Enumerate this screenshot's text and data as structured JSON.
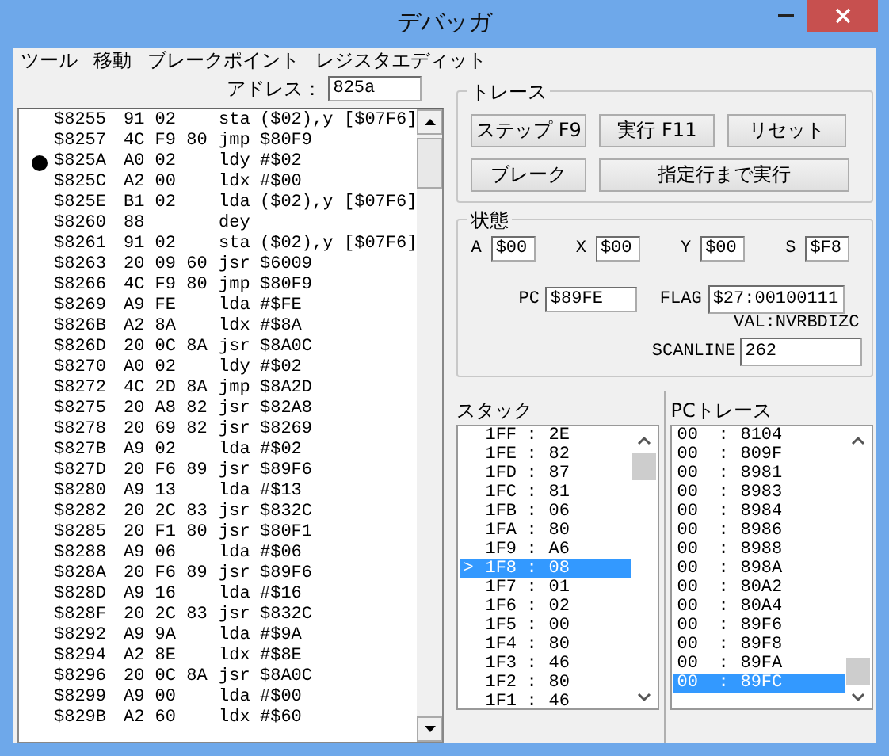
{
  "window": {
    "title": "デバッガ"
  },
  "menu": [
    "ツール",
    "移動",
    "ブレークポイント",
    "レジスタエディット"
  ],
  "address": {
    "label": "アドレス：",
    "value": "825a"
  },
  "disassembly": [
    {
      "address": "$8255",
      "bytes": "91 02",
      "mnemonic": "sta",
      "operand": "($02),y",
      "effective": "[$07F6]",
      "breakpoint": false
    },
    {
      "address": "$8257",
      "bytes": "4C F9 80",
      "mnemonic": "jmp",
      "operand": "$80F9",
      "breakpoint": false
    },
    {
      "address": "$825A",
      "bytes": "A0 02",
      "mnemonic": "ldy",
      "operand": "#$02",
      "breakpoint": true
    },
    {
      "address": "$825C",
      "bytes": "A2 00",
      "mnemonic": "ldx",
      "operand": "#$00",
      "breakpoint": false
    },
    {
      "address": "$825E",
      "bytes": "B1 02",
      "mnemonic": "lda",
      "operand": "($02),y",
      "effective": "[$07F6]",
      "breakpoint": false
    },
    {
      "address": "$8260",
      "bytes": "88",
      "mnemonic": "dey",
      "breakpoint": false
    },
    {
      "address": "$8261",
      "bytes": "91 02",
      "mnemonic": "sta",
      "operand": "($02),y",
      "effective": "[$07F6]",
      "breakpoint": false
    },
    {
      "address": "$8263",
      "bytes": "20 09 60",
      "mnemonic": "jsr",
      "operand": "$6009",
      "breakpoint": false
    },
    {
      "address": "$8266",
      "bytes": "4C F9 80",
      "mnemonic": "jmp",
      "operand": "$80F9",
      "breakpoint": false
    },
    {
      "address": "$8269",
      "bytes": "A9 FE",
      "mnemonic": "lda",
      "operand": "#$FE",
      "breakpoint": false
    },
    {
      "address": "$826B",
      "bytes": "A2 8A",
      "mnemonic": "ldx",
      "operand": "#$8A",
      "breakpoint": false
    },
    {
      "address": "$826D",
      "bytes": "20 0C 8A",
      "mnemonic": "jsr",
      "operand": "$8A0C",
      "breakpoint": false
    },
    {
      "address": "$8270",
      "bytes": "A0 02",
      "mnemonic": "ldy",
      "operand": "#$02",
      "breakpoint": false
    },
    {
      "address": "$8272",
      "bytes": "4C 2D 8A",
      "mnemonic": "jmp",
      "operand": "$8A2D",
      "breakpoint": false
    },
    {
      "address": "$8275",
      "bytes": "20 A8 82",
      "mnemonic": "jsr",
      "operand": "$82A8",
      "breakpoint": false
    },
    {
      "address": "$8278",
      "bytes": "20 69 82",
      "mnemonic": "jsr",
      "operand": "$8269",
      "breakpoint": false
    },
    {
      "address": "$827B",
      "bytes": "A9 02",
      "mnemonic": "lda",
      "operand": "#$02",
      "breakpoint": false
    },
    {
      "address": "$827D",
      "bytes": "20 F6 89",
      "mnemonic": "jsr",
      "operand": "$89F6",
      "breakpoint": false
    },
    {
      "address": "$8280",
      "bytes": "A9 13",
      "mnemonic": "lda",
      "operand": "#$13",
      "breakpoint": false
    },
    {
      "address": "$8282",
      "bytes": "20 2C 83",
      "mnemonic": "jsr",
      "operand": "$832C",
      "breakpoint": false
    },
    {
      "address": "$8285",
      "bytes": "20 F1 80",
      "mnemonic": "jsr",
      "operand": "$80F1",
      "breakpoint": false
    },
    {
      "address": "$8288",
      "bytes": "A9 06",
      "mnemonic": "lda",
      "operand": "#$06",
      "breakpoint": false
    },
    {
      "address": "$828A",
      "bytes": "20 F6 89",
      "mnemonic": "jsr",
      "operand": "$89F6",
      "breakpoint": false
    },
    {
      "address": "$828D",
      "bytes": "A9 16",
      "mnemonic": "lda",
      "operand": "#$16",
      "breakpoint": false
    },
    {
      "address": "$828F",
      "bytes": "20 2C 83",
      "mnemonic": "jsr",
      "operand": "$832C",
      "breakpoint": false
    },
    {
      "address": "$8292",
      "bytes": "A9 9A",
      "mnemonic": "lda",
      "operand": "#$9A",
      "breakpoint": false
    },
    {
      "address": "$8294",
      "bytes": "A2 8E",
      "mnemonic": "ldx",
      "operand": "#$8E",
      "breakpoint": false
    },
    {
      "address": "$8296",
      "bytes": "20 0C 8A",
      "mnemonic": "jsr",
      "operand": "$8A0C",
      "breakpoint": false
    },
    {
      "address": "$8299",
      "bytes": "A9 00",
      "mnemonic": "lda",
      "operand": "#$00",
      "breakpoint": false
    },
    {
      "address": "$829B",
      "bytes": "A2 60",
      "mnemonic": "ldx",
      "operand": "#$60",
      "breakpoint": false
    }
  ],
  "trace": {
    "title": "トレース",
    "buttons": [
      [
        "ステップ F9",
        "実行 F11",
        "リセット"
      ],
      [
        "ブレーク",
        "指定行まで実行"
      ]
    ]
  },
  "status": {
    "title": "状態",
    "registers": [
      {
        "label": "A",
        "value": "$00"
      },
      {
        "label": "X",
        "value": "$00"
      },
      {
        "label": "Y",
        "value": "$00"
      },
      {
        "label": "S",
        "value": "$F8"
      }
    ],
    "pc": {
      "label": "PC",
      "value": "$89FE"
    },
    "flag": {
      "label": "FLAG",
      "value": "$27:00100111",
      "note": "VAL:NVRBDIZC"
    },
    "scanline": {
      "label": "SCANLINE",
      "value": "262"
    }
  },
  "stack": {
    "title": "スタック",
    "items": [
      {
        "address": "1FF",
        "separator": ":",
        "value": "2E",
        "selected": false
      },
      {
        "address": "1FE",
        "separator": ":",
        "value": "82",
        "selected": false
      },
      {
        "address": "1FD",
        "separator": ":",
        "value": "87",
        "selected": false
      },
      {
        "address": "1FC",
        "separator": ":",
        "value": "81",
        "selected": false
      },
      {
        "address": "1FB",
        "separator": ":",
        "value": "06",
        "selected": false
      },
      {
        "address": "1FA",
        "separator": ":",
        "value": "80",
        "selected": false
      },
      {
        "address": "1F9",
        "separator": ":",
        "value": "A6",
        "selected": false
      },
      {
        "address": "1F8",
        "separator": ":",
        "value": "08",
        "selected": true,
        "pointer": ">"
      },
      {
        "address": "1F7",
        "separator": ":",
        "value": "01",
        "selected": false
      },
      {
        "address": "1F6",
        "separator": ":",
        "value": "02",
        "selected": false
      },
      {
        "address": "1F5",
        "separator": ":",
        "value": "00",
        "selected": false
      },
      {
        "address": "1F4",
        "separator": ":",
        "value": "80",
        "selected": false
      },
      {
        "address": "1F3",
        "separator": ":",
        "value": "46",
        "selected": false
      },
      {
        "address": "1F2",
        "separator": ":",
        "value": "80",
        "selected": false
      },
      {
        "address": "1F1",
        "separator": ":",
        "value": "46",
        "selected": false
      }
    ]
  },
  "pc_trace": {
    "title": "PCトレース",
    "items": [
      {
        "bank": "00",
        "separator": ":",
        "address": "8104",
        "selected": false
      },
      {
        "bank": "00",
        "separator": ":",
        "address": "809F",
        "selected": false
      },
      {
        "bank": "00",
        "separator": ":",
        "address": "8981",
        "selected": false
      },
      {
        "bank": "00",
        "separator": ":",
        "address": "8983",
        "selected": false
      },
      {
        "bank": "00",
        "separator": ":",
        "address": "8984",
        "selected": false
      },
      {
        "bank": "00",
        "separator": ":",
        "address": "8986",
        "selected": false
      },
      {
        "bank": "00",
        "separator": ":",
        "address": "8988",
        "selected": false
      },
      {
        "bank": "00",
        "separator": ":",
        "address": "898A",
        "selected": false
      },
      {
        "bank": "00",
        "separator": ":",
        "address": "80A2",
        "selected": false
      },
      {
        "bank": "00",
        "separator": ":",
        "address": "80A4",
        "selected": false
      },
      {
        "bank": "00",
        "separator": ":",
        "address": "89F6",
        "selected": false
      },
      {
        "bank": "00",
        "separator": ":",
        "address": "89F8",
        "selected": false
      },
      {
        "bank": "00",
        "separator": ":",
        "address": "89FA",
        "selected": false
      },
      {
        "bank": "00",
        "separator": ":",
        "address": "89FC",
        "selected": true
      }
    ]
  }
}
